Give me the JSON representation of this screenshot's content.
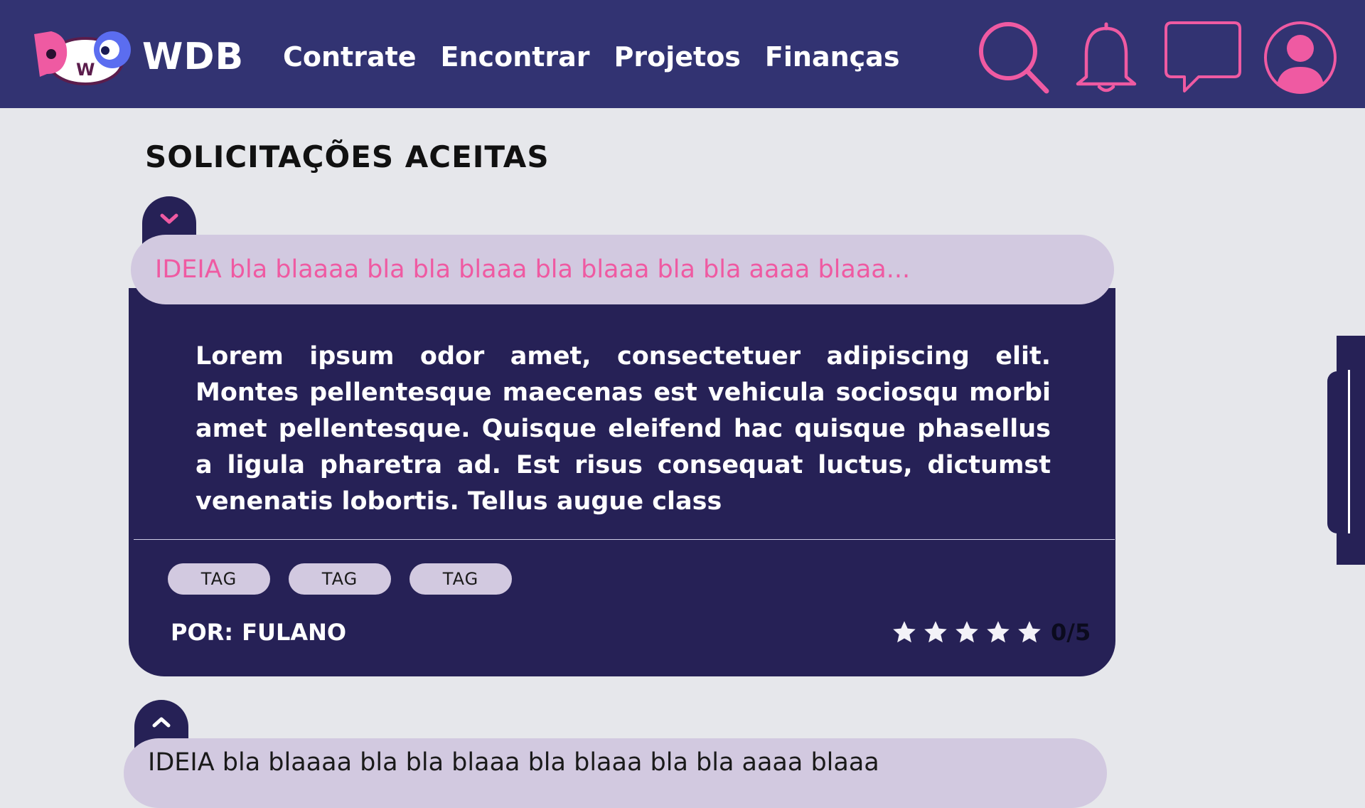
{
  "header": {
    "brand": "WDB",
    "logo_letters": {
      "d": "D",
      "w": "W",
      "o": "O"
    },
    "nav": [
      "Contrate",
      "Encontrar",
      "Projetos",
      "Finanças"
    ],
    "icons": [
      "search-icon",
      "bell-icon",
      "chat-icon",
      "profile-icon"
    ]
  },
  "page": {
    "title": "SOLICITAÇÕES ACEITAS"
  },
  "card": {
    "header": "IDEIA bla blaaaa bla bla blaaa bla blaaa bla bla aaaa blaaa...",
    "description": "Lorem ipsum odor amet, consectetuer adipiscing elit. Montes pellentesque maecenas est vehicula sociosqu morbi amet pellentesque. Quisque eleifend hac quisque phasellus a ligula pharetra ad. Est risus consequat luctus, dictumst venenatis lobortis. Tellus augue class",
    "tags": [
      "TAG",
      "TAG",
      "TAG"
    ],
    "author_label": "POR:",
    "author_name": "FULANO",
    "rating": {
      "value": 0,
      "max": 5,
      "text": "0/5"
    },
    "toggle_icon": "chevron-down-icon"
  },
  "card2": {
    "header": "IDEIA bla blaaaa bla bla blaaa bla blaaa bla bla aaaa blaaa",
    "toggle_icon": "chevron-up-icon"
  },
  "colors": {
    "header_bg": "#323372",
    "accent_pink": "#ef5aa2",
    "card_bg": "#262156",
    "lavender": "#d2c9e0",
    "page_bg": "#e6e7eb"
  }
}
